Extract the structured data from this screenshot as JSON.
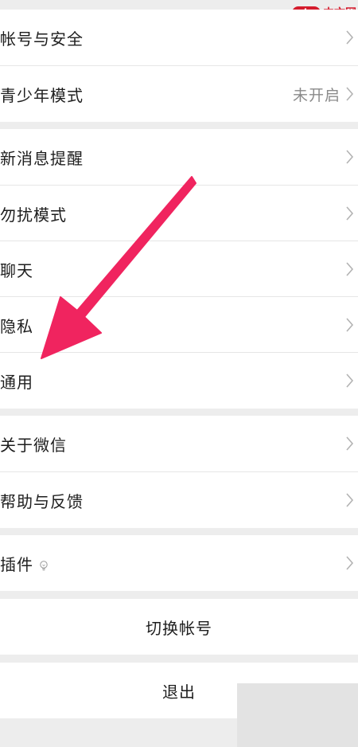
{
  "watermark": {
    "logo": "php",
    "text": "中文网"
  },
  "groups": {
    "account": {
      "items": [
        {
          "label": "帐号与安全",
          "value": ""
        },
        {
          "label": "青少年模式",
          "value": "未开启"
        }
      ]
    },
    "settings": {
      "items": [
        {
          "label": "新消息提醒"
        },
        {
          "label": "勿扰模式"
        },
        {
          "label": "聊天"
        },
        {
          "label": "隐私"
        },
        {
          "label": "通用"
        }
      ]
    },
    "about": {
      "items": [
        {
          "label": "关于微信"
        },
        {
          "label": "帮助与反馈"
        }
      ]
    },
    "plugins": {
      "label": "插件"
    }
  },
  "actions": {
    "switch_account": "切换帐号",
    "logout": "退出"
  },
  "colors": {
    "arrow": "#f0245f",
    "background": "#ededed",
    "card": "#ffffff",
    "chevron": "#b3b3b3"
  }
}
